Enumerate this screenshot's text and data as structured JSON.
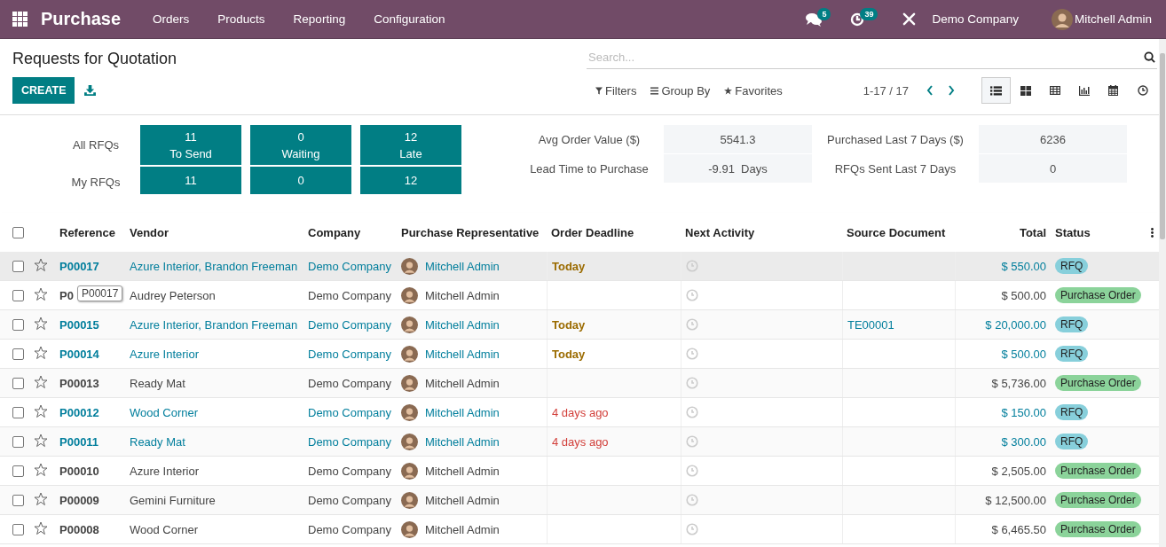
{
  "navbar": {
    "app_title": "Purchase",
    "menu": [
      "Orders",
      "Products",
      "Reporting",
      "Configuration"
    ],
    "messages_badge": "5",
    "activities_badge": "39",
    "company": "Demo Company",
    "user": "Mitchell Admin"
  },
  "control_panel": {
    "title": "Requests for Quotation",
    "create_button": "CREATE",
    "search": {
      "placeholder": "Search..."
    },
    "filters": "Filters",
    "group_by": "Group By",
    "favorites": "Favorites",
    "pager": "1-17 / 17",
    "views": [
      {
        "kind": "list",
        "selected": true
      },
      {
        "kind": "kanban",
        "selected": false
      },
      {
        "kind": "pivot",
        "selected": false
      },
      {
        "kind": "graph",
        "selected": false
      },
      {
        "kind": "calendar",
        "selected": false
      },
      {
        "kind": "activity",
        "selected": false
      }
    ]
  },
  "dashboard": {
    "row_labels": [
      "All RFQs",
      "My RFQs"
    ],
    "tiles": [
      {
        "count": "11",
        "label": "To Send",
        "my_count": "11"
      },
      {
        "count": "0",
        "label": "Waiting",
        "my_count": "0"
      },
      {
        "count": "12",
        "label": "Late",
        "my_count": "12"
      }
    ],
    "stats": [
      {
        "label": "Avg Order Value ($)",
        "value": "5541.3"
      },
      {
        "label": "Purchased Last 7 Days ($)",
        "value": "6236"
      },
      {
        "label": "Lead Time to Purchase",
        "value": "-9.91  Days"
      },
      {
        "label": "RFQs Sent Last 7 Days",
        "value": "0"
      }
    ]
  },
  "table": {
    "header_checked": false,
    "columns": [
      "Reference",
      "Vendor",
      "Company",
      "Purchase Representative",
      "Order Deadline",
      "Next Activity",
      "Source Document",
      "Total",
      "Status"
    ],
    "tooltip": "P00017",
    "rows": [
      {
        "reference": "P00017",
        "vendor": "Azure Interior, Brandon Freeman",
        "company": "Demo Company",
        "representative": "Mitchell Admin",
        "deadline": {
          "text": "Today",
          "overdue": false
        },
        "total": "$ 550.00",
        "status": "RFQ",
        "kind": "rfq",
        "checked": false,
        "starred": false,
        "hovered": true
      },
      {
        "reference": "P0",
        "vendor": "Audrey Peterson",
        "company": "Demo Company",
        "representative": "Mitchell Admin",
        "total": "$ 500.00",
        "status": "Purchase Order",
        "kind": "purchase",
        "checked": false,
        "starred": false,
        "hovered": false
      },
      {
        "reference": "P00015",
        "vendor": "Azure Interior, Brandon Freeman",
        "company": "Demo Company",
        "representative": "Mitchell Admin",
        "deadline": {
          "text": "Today",
          "overdue": false
        },
        "source": "TE00001",
        "total": "$ 20,000.00",
        "status": "RFQ",
        "kind": "rfq",
        "checked": false,
        "starred": false,
        "hovered": false
      },
      {
        "reference": "P00014",
        "vendor": "Azure Interior",
        "company": "Demo Company",
        "representative": "Mitchell Admin",
        "deadline": {
          "text": "Today",
          "overdue": false
        },
        "total": "$ 500.00",
        "status": "RFQ",
        "kind": "rfq",
        "checked": false,
        "starred": false,
        "hovered": false
      },
      {
        "reference": "P00013",
        "vendor": "Ready Mat",
        "company": "Demo Company",
        "representative": "Mitchell Admin",
        "total": "$ 5,736.00",
        "status": "Purchase Order",
        "kind": "purchase",
        "checked": false,
        "starred": false,
        "hovered": false
      },
      {
        "reference": "P00012",
        "vendor": "Wood Corner",
        "company": "Demo Company",
        "representative": "Mitchell Admin",
        "deadline": {
          "text": "4 days ago",
          "overdue": true
        },
        "total": "$ 150.00",
        "status": "RFQ",
        "kind": "rfq",
        "checked": false,
        "starred": false,
        "hovered": false
      },
      {
        "reference": "P00011",
        "vendor": "Ready Mat",
        "company": "Demo Company",
        "representative": "Mitchell Admin",
        "deadline": {
          "text": "4 days ago",
          "overdue": true
        },
        "total": "$ 300.00",
        "status": "RFQ",
        "kind": "rfq",
        "checked": false,
        "starred": false,
        "hovered": false
      },
      {
        "reference": "P00010",
        "vendor": "Azure Interior",
        "company": "Demo Company",
        "representative": "Mitchell Admin",
        "total": "$ 2,505.00",
        "status": "Purchase Order",
        "kind": "purchase",
        "checked": false,
        "starred": false,
        "hovered": false
      },
      {
        "reference": "P00009",
        "vendor": "Gemini Furniture",
        "company": "Demo Company",
        "representative": "Mitchell Admin",
        "total": "$ 12,500.00",
        "status": "Purchase Order",
        "kind": "purchase",
        "checked": false,
        "starred": false,
        "hovered": false
      },
      {
        "reference": "P00008",
        "vendor": "Wood Corner",
        "company": "Demo Company",
        "representative": "Mitchell Admin",
        "total": "$ 6,465.50",
        "status": "Purchase Order",
        "kind": "purchase",
        "checked": false,
        "starred": false,
        "hovered": false
      }
    ]
  }
}
